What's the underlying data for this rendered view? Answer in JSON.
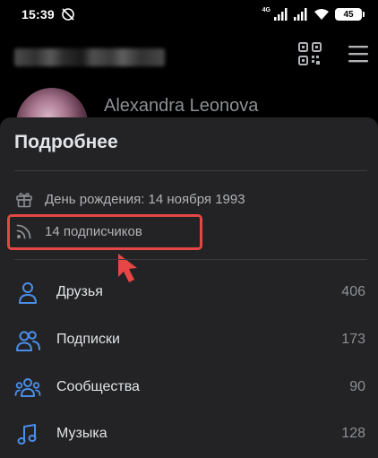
{
  "status_bar": {
    "time": "15:39",
    "network": "4G",
    "battery": "45"
  },
  "profile": {
    "name": "Alexandra Leonova"
  },
  "sheet": {
    "title": "Подробнее",
    "info": [
      {
        "icon": "gift-icon",
        "text": "День рождения: 14 ноября 1993"
      },
      {
        "icon": "rss-icon",
        "text": "14 подписчиков"
      }
    ],
    "nav": [
      {
        "icon": "person-icon",
        "label": "Друзья",
        "count": "406"
      },
      {
        "icon": "people-icon",
        "label": "Подписки",
        "count": "173"
      },
      {
        "icon": "communities-icon",
        "label": "Сообщества",
        "count": "90"
      },
      {
        "icon": "music-note-icon",
        "label": "Музыка",
        "count": "128"
      }
    ]
  },
  "colors": {
    "accent": "#4a8ee8",
    "highlight": "#e64646",
    "sheet_bg": "#232325"
  }
}
